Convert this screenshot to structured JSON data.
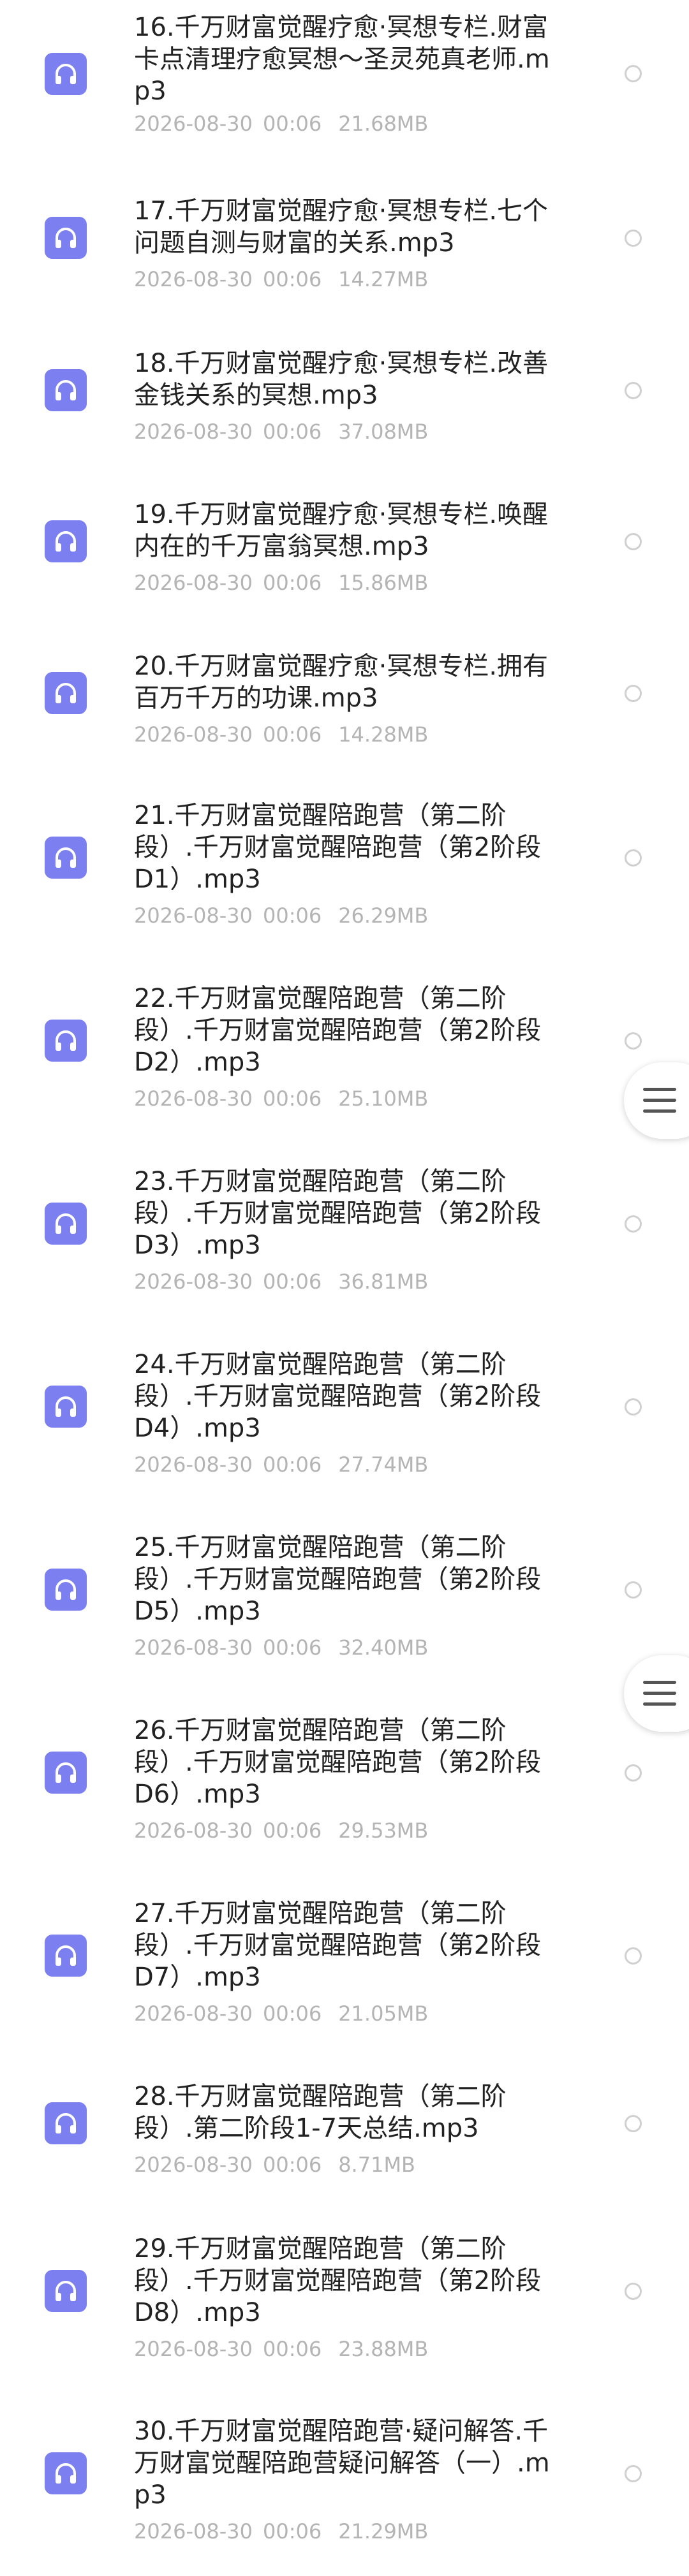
{
  "files": [
    {
      "name": "16.千万财富觉醒疗愈·冥想专栏.财富卡点清理疗愈冥想～圣灵苑真老师.mp3",
      "date": "2026-08-30",
      "time": "00:06",
      "size": "21.68MB"
    },
    {
      "name": "17.千万财富觉醒疗愈·冥想专栏.七个问题自测与财富的关系.mp3",
      "date": "2026-08-30",
      "time": "00:06",
      "size": "14.27MB"
    },
    {
      "name": "18.千万财富觉醒疗愈·冥想专栏.改善金钱关系的冥想.mp3",
      "date": "2026-08-30",
      "time": "00:06",
      "size": "37.08MB"
    },
    {
      "name": "19.千万财富觉醒疗愈·冥想专栏.唤醒内在的千万富翁冥想.mp3",
      "date": "2026-08-30",
      "time": "00:06",
      "size": "15.86MB"
    },
    {
      "name": "20.千万财富觉醒疗愈·冥想专栏.拥有百万千万的功课.mp3",
      "date": "2026-08-30",
      "time": "00:06",
      "size": "14.28MB"
    },
    {
      "name": "21.千万财富觉醒陪跑营（第二阶段）.千万财富觉醒陪跑营（第2阶段D1）.mp3",
      "date": "2026-08-30",
      "time": "00:06",
      "size": "26.29MB"
    },
    {
      "name": "22.千万财富觉醒陪跑营（第二阶段）.千万财富觉醒陪跑营（第2阶段D2）.mp3",
      "date": "2026-08-30",
      "time": "00:06",
      "size": "25.10MB"
    },
    {
      "name": "23.千万财富觉醒陪跑营（第二阶段）.千万财富觉醒陪跑营（第2阶段D3）.mp3",
      "date": "2026-08-30",
      "time": "00:06",
      "size": "36.81MB"
    },
    {
      "name": "24.千万财富觉醒陪跑营（第二阶段）.千万财富觉醒陪跑营（第2阶段D4）.mp3",
      "date": "2026-08-30",
      "time": "00:06",
      "size": "27.74MB"
    },
    {
      "name": "25.千万财富觉醒陪跑营（第二阶段）.千万财富觉醒陪跑营（第2阶段D5）.mp3",
      "date": "2026-08-30",
      "time": "00:06",
      "size": "32.40MB"
    },
    {
      "name": "26.千万财富觉醒陪跑营（第二阶段）.千万财富觉醒陪跑营（第2阶段D6）.mp3",
      "date": "2026-08-30",
      "time": "00:06",
      "size": "29.53MB"
    },
    {
      "name": "27.千万财富觉醒陪跑营（第二阶段）.千万财富觉醒陪跑营（第2阶段D7）.mp3",
      "date": "2026-08-30",
      "time": "00:06",
      "size": "21.05MB"
    },
    {
      "name": "28.千万财富觉醒陪跑营（第二阶段）.第二阶段1-7天总结.mp3",
      "date": "2026-08-30",
      "time": "00:06",
      "size": "8.71MB"
    },
    {
      "name": "29.千万财富觉醒陪跑营（第二阶段）.千万财富觉醒陪跑营（第2阶段D8）.mp3",
      "date": "2026-08-30",
      "time": "00:06",
      "size": "23.88MB"
    },
    {
      "name": "30.千万财富觉醒陪跑营·疑问解答.千万财富觉醒陪跑营疑问解答（一）.mp3",
      "date": "2026-08-30",
      "time": "00:06",
      "size": "21.29MB"
    }
  ],
  "icons": {
    "file_icon": "headphones-icon",
    "menu_icon": "hamburger-menu-icon"
  },
  "colors": {
    "icon_bg": "#7b7ff0",
    "name_text": "#222222",
    "meta_text": "#b4b4b4",
    "radio_border": "#d0d0d0"
  }
}
